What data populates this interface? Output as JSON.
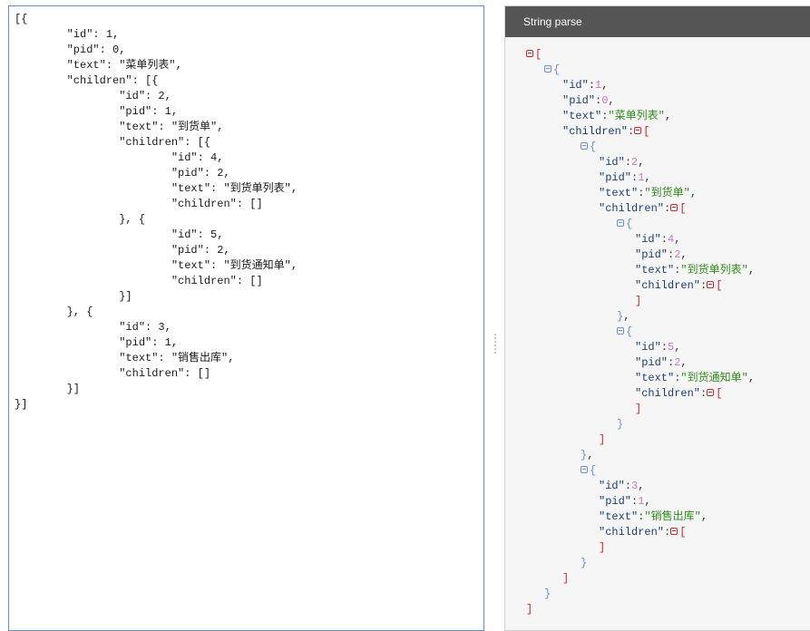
{
  "editor": {
    "lines": [
      "[{",
      "        \"id\": 1,",
      "        \"pid\": 0,",
      "        \"text\": \"菜单列表\",",
      "        \"children\": [{",
      "                \"id\": 2,",
      "                \"pid\": 1,",
      "                \"text\": \"到货单\",",
      "                \"children\": [{",
      "                        \"id\": 4,",
      "                        \"pid\": 2,",
      "                        \"text\": \"到货单列表\",",
      "                        \"children\": []",
      "                }, {",
      "                        \"id\": 5,",
      "                        \"pid\": 2,",
      "                        \"text\": \"到货通知单\",",
      "                        \"children\": []",
      "                }]",
      "        }, {",
      "                \"id\": 3,",
      "                \"pid\": 1,",
      "                \"text\": \"销售出库\",",
      "                \"children\": []",
      "        }]",
      "}]"
    ]
  },
  "panel": {
    "title": "String parse"
  },
  "tree": {
    "rows": [
      {
        "d": 0,
        "t": "open_arr",
        "toggle": "arr"
      },
      {
        "d": 1,
        "t": "open_obj",
        "toggle": "obj"
      },
      {
        "d": 2,
        "t": "kv",
        "key": "\"id\"",
        "val": "1",
        "vt": "num"
      },
      {
        "d": 2,
        "t": "kv",
        "key": "\"pid\"",
        "val": "0",
        "vt": "num"
      },
      {
        "d": 2,
        "t": "kv",
        "key": "\"text\"",
        "val": "\"菜单列表\"",
        "vt": "str"
      },
      {
        "d": 2,
        "t": "karr",
        "key": "\"children\""
      },
      {
        "d": 3,
        "t": "open_obj",
        "toggle": "obj"
      },
      {
        "d": 4,
        "t": "kv",
        "key": "\"id\"",
        "val": "2",
        "vt": "num"
      },
      {
        "d": 4,
        "t": "kv",
        "key": "\"pid\"",
        "val": "1",
        "vt": "num"
      },
      {
        "d": 4,
        "t": "kv",
        "key": "\"text\"",
        "val": "\"到货单\"",
        "vt": "str"
      },
      {
        "d": 4,
        "t": "karr",
        "key": "\"children\""
      },
      {
        "d": 5,
        "t": "open_obj",
        "toggle": "obj"
      },
      {
        "d": 6,
        "t": "kv",
        "key": "\"id\"",
        "val": "4",
        "vt": "num"
      },
      {
        "d": 6,
        "t": "kv",
        "key": "\"pid\"",
        "val": "2",
        "vt": "num"
      },
      {
        "d": 6,
        "t": "kv",
        "key": "\"text\"",
        "val": "\"到货单列表\"",
        "vt": "str"
      },
      {
        "d": 6,
        "t": "karr",
        "key": "\"children\""
      },
      {
        "d": 6,
        "t": "close_arr",
        "comma": false
      },
      {
        "d": 5,
        "t": "close_obj",
        "comma": true
      },
      {
        "d": 5,
        "t": "open_obj",
        "toggle": "obj"
      },
      {
        "d": 6,
        "t": "kv",
        "key": "\"id\"",
        "val": "5",
        "vt": "num"
      },
      {
        "d": 6,
        "t": "kv",
        "key": "\"pid\"",
        "val": "2",
        "vt": "num"
      },
      {
        "d": 6,
        "t": "kv",
        "key": "\"text\"",
        "val": "\"到货通知单\"",
        "vt": "str"
      },
      {
        "d": 6,
        "t": "karr",
        "key": "\"children\""
      },
      {
        "d": 6,
        "t": "close_arr",
        "comma": false
      },
      {
        "d": 5,
        "t": "close_obj",
        "comma": false
      },
      {
        "d": 4,
        "t": "close_arr",
        "comma": false
      },
      {
        "d": 3,
        "t": "close_obj",
        "comma": true
      },
      {
        "d": 3,
        "t": "open_obj",
        "toggle": "obj"
      },
      {
        "d": 4,
        "t": "kv",
        "key": "\"id\"",
        "val": "3",
        "vt": "num"
      },
      {
        "d": 4,
        "t": "kv",
        "key": "\"pid\"",
        "val": "1",
        "vt": "num"
      },
      {
        "d": 4,
        "t": "kv",
        "key": "\"text\"",
        "val": "\"销售出库\"",
        "vt": "str"
      },
      {
        "d": 4,
        "t": "karr",
        "key": "\"children\""
      },
      {
        "d": 4,
        "t": "close_arr",
        "comma": false
      },
      {
        "d": 3,
        "t": "close_obj",
        "comma": false
      },
      {
        "d": 2,
        "t": "close_arr",
        "comma": false
      },
      {
        "d": 1,
        "t": "close_obj",
        "comma": false
      },
      {
        "d": 0,
        "t": "close_arr",
        "comma": false
      }
    ]
  },
  "colors": {
    "accent_border": "#5b8fd6",
    "header_bg": "#555555",
    "array_bracket": "#c62828",
    "object_brace": "#6b8fcf",
    "string_value": "#2f8a1b",
    "number_value": "#c678c6"
  }
}
